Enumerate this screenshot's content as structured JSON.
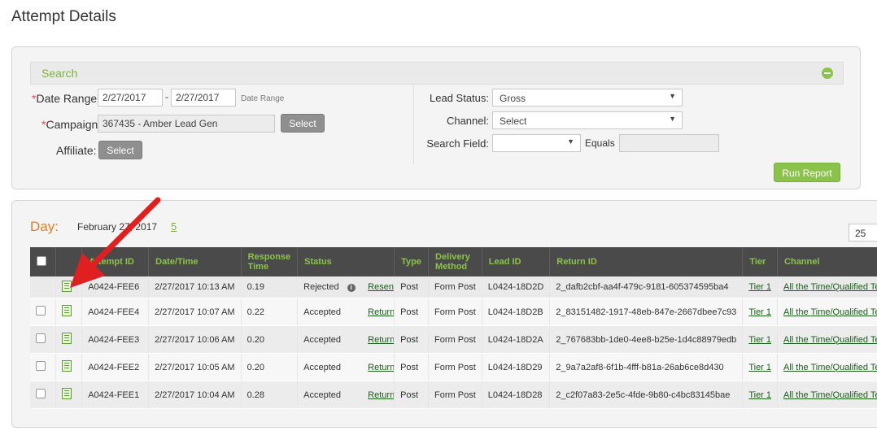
{
  "page": {
    "title": "Attempt Details"
  },
  "search": {
    "title": "Search",
    "date_range_label": "Date Range:",
    "date_from": "2/27/2017",
    "date_to": "2/27/2017",
    "date_sep": "-",
    "date_hint": "Date Range",
    "campaign_label": "Campaign:",
    "campaign_value": "367435 - Amber Lead Gen",
    "campaign_select": "Select",
    "affiliate_label": "Affiliate:",
    "affiliate_select": "Select",
    "required_mark": "*",
    "lead_status_label": "Lead Status:",
    "lead_status_value": "Gross",
    "channel_label": "Channel:",
    "channel_value": "Select",
    "search_field_label": "Search Field:",
    "search_field_value": "",
    "equals_label": "Equals",
    "equals_value": "",
    "run_report": "Run Report"
  },
  "results": {
    "day_label": "Day:",
    "day_date": "February 27, 2017",
    "day_count": "5",
    "page_size": "25",
    "columns": [
      "",
      "",
      "Attempt ID",
      "Date/Time",
      "Response Time",
      "Status",
      "Type",
      "Delivery Method",
      "Lead ID",
      "Return ID",
      "Tier",
      "Channel"
    ],
    "rows": [
      {
        "attempt_id": "A0424-FEE6",
        "datetime": "2/27/2017 10:13 AM",
        "response": "0.19",
        "status": "Rejected",
        "action": "Resend",
        "type": "Post",
        "delivery": "Form Post",
        "lead_id": "L0424-18D2D",
        "return_id": "2_dafb2cbf-aa4f-479c-9181-605374595ba4",
        "tier": "Tier 1",
        "channel": "All the Time/Qualified Tes"
      },
      {
        "attempt_id": "A0424-FEE4",
        "datetime": "2/27/2017 10:07 AM",
        "response": "0.22",
        "status": "Accepted",
        "action": "Return",
        "type": "Post",
        "delivery": "Form Post",
        "lead_id": "L0424-18D2B",
        "return_id": "2_83151482-1917-48eb-847e-2667dbee7c93",
        "tier": "Tier 1",
        "channel": "All the Time/Qualified Tes"
      },
      {
        "attempt_id": "A0424-FEE3",
        "datetime": "2/27/2017 10:06 AM",
        "response": "0.20",
        "status": "Accepted",
        "action": "Return",
        "type": "Post",
        "delivery": "Form Post",
        "lead_id": "L0424-18D2A",
        "return_id": "2_767683bb-1de0-4ee8-b25e-1d4c88979edb",
        "tier": "Tier 1",
        "channel": "All the Time/Qualified Tes"
      },
      {
        "attempt_id": "A0424-FEE2",
        "datetime": "2/27/2017 10:05 AM",
        "response": "0.20",
        "status": "Accepted",
        "action": "Return",
        "type": "Post",
        "delivery": "Form Post",
        "lead_id": "L0424-18D29",
        "return_id": "2_9a7a2af8-6f1b-4fff-b81a-26ab6ce8d430",
        "tier": "Tier 1",
        "channel": "All the Time/Qualified Tes"
      },
      {
        "attempt_id": "A0424-FEE1",
        "datetime": "2/27/2017 10:04 AM",
        "response": "0.28",
        "status": "Accepted",
        "action": "Return",
        "type": "Post",
        "delivery": "Form Post",
        "lead_id": "L0424-18D28",
        "return_id": "2_c2f07a83-2e5c-4fde-9b80-c4bc83145bae",
        "tier": "Tier 1",
        "channel": "All the Time/Qualified Tes"
      }
    ]
  },
  "colors": {
    "accent": "#8bc34a",
    "day_label": "#e67e22",
    "annotation_arrow": "#e02020",
    "header_bg": "#4a4a4a"
  }
}
